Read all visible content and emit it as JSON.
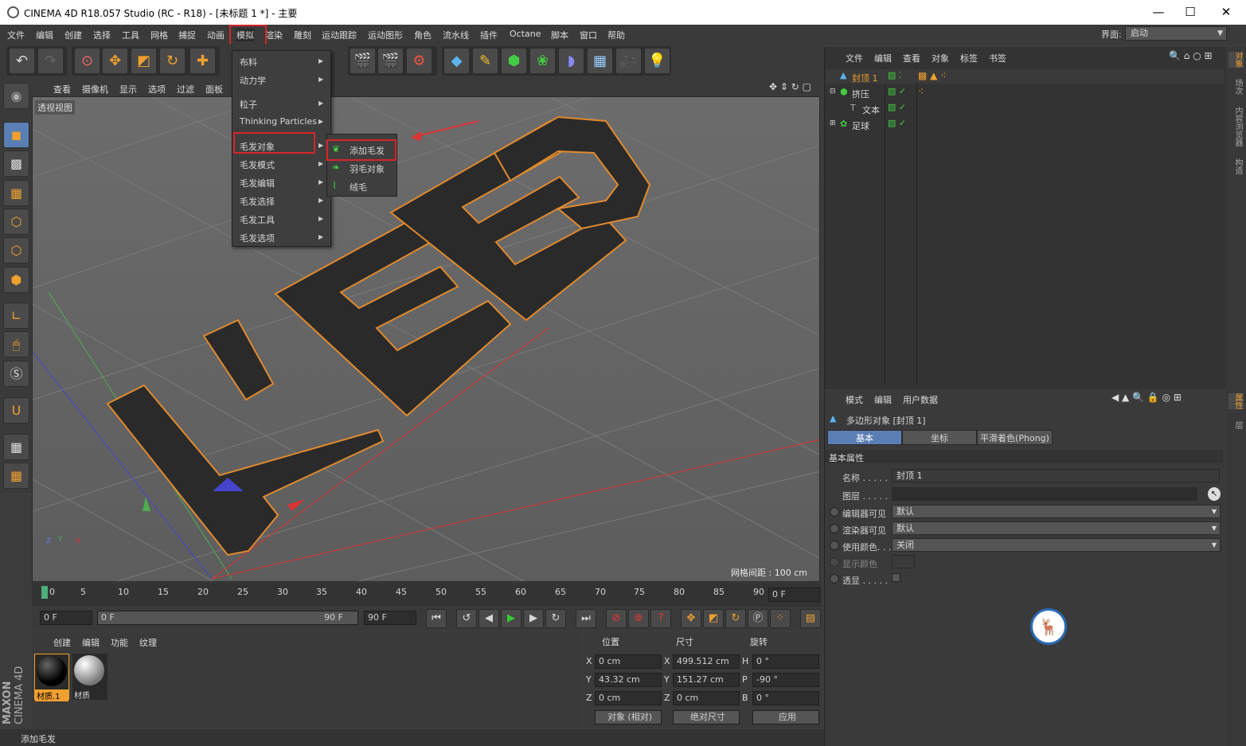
{
  "titlebar": {
    "title": "CINEMA 4D R18.057 Studio (RC - R18) - [未标题 1 *] - 主要",
    "minimize": "—",
    "maximize": "☐",
    "close": "✕"
  },
  "menubar": {
    "items": [
      "文件",
      "编辑",
      "创建",
      "选择",
      "工具",
      "网格",
      "捕捉",
      "动画",
      "模拟",
      "渲染",
      "雕刻",
      "运动跟踪",
      "运动图形",
      "角色",
      "流水线",
      "插件",
      "Octane",
      "脚本",
      "窗口",
      "帮助"
    ],
    "layout_label": "界面:",
    "layout_value": "启动"
  },
  "viewport": {
    "menu": [
      "查看",
      "摄像机",
      "显示",
      "选项",
      "过滤",
      "面板"
    ],
    "label": "透视视图",
    "grid_distance": "网格间距 : 100 cm",
    "scene_text": "KEEP"
  },
  "dropdown": {
    "items": [
      "布料",
      "动力学",
      "粒子",
      "Thinking Particles",
      "毛发对象",
      "毛发模式",
      "毛发编辑",
      "毛发选择",
      "毛发工具",
      "毛发选项"
    ]
  },
  "submenu": {
    "items": [
      "添加毛发",
      "羽毛对象",
      "绒毛"
    ]
  },
  "timeline": {
    "ticks": [
      "0",
      "5",
      "10",
      "15",
      "20",
      "25",
      "30",
      "35",
      "40",
      "45",
      "50",
      "55",
      "60",
      "65",
      "70",
      "75",
      "80",
      "85",
      "90"
    ],
    "current_frame": "0 F",
    "start": "0 F",
    "range_start": "0 F",
    "range_end": "90 F",
    "end": "90 F"
  },
  "materials": {
    "menu": [
      "创建",
      "编辑",
      "功能",
      "纹理"
    ],
    "items": [
      "材质.1",
      "材质"
    ]
  },
  "coords": {
    "headers": [
      "位置",
      "尺寸",
      "旋转"
    ],
    "rows": [
      {
        "axis": "X",
        "pos": "0 cm",
        "sizeAxis": "X",
        "size": "499.512 cm",
        "rotAxis": "H",
        "rot": "0 °"
      },
      {
        "axis": "Y",
        "pos": "43.32 cm",
        "sizeAxis": "Y",
        "size": "151.27 cm",
        "rotAxis": "P",
        "rot": "-90 °"
      },
      {
        "axis": "Z",
        "pos": "0 cm",
        "sizeAxis": "Z",
        "size": "0 cm",
        "rotAxis": "B",
        "rot": "0 °"
      }
    ],
    "mode": "对象 (相对)",
    "size_mode": "绝对尺寸",
    "apply": "应用"
  },
  "statusbar": {
    "text": "添加毛发"
  },
  "brand": {
    "maxon": "MAXON",
    "c4d": "CINEMA 4D"
  },
  "objects": {
    "menu": [
      "文件",
      "编辑",
      "查看",
      "对象",
      "标签",
      "书签"
    ],
    "rows": [
      "封顶 1",
      "挤压",
      "文本",
      "足球"
    ]
  },
  "attributes": {
    "menu": [
      "模式",
      "编辑",
      "用户数据"
    ],
    "object_title": "多边形对象 [封顶 1]",
    "tabs": [
      "基本",
      "坐标",
      "平滑着色(Phong)"
    ],
    "section": "基本属性",
    "props": [
      {
        "label": "名称 . . . . .",
        "value": "封顶 1"
      },
      {
        "label": "图层 . . . . .",
        "value": ""
      },
      {
        "label": "编辑器可见",
        "value": "默认"
      },
      {
        "label": "渲染器可见",
        "value": "默认"
      },
      {
        "label": "使用颜色. . .",
        "value": "关闭"
      },
      {
        "label": "显示颜色",
        "value": ""
      },
      {
        "label": "透显 . . . . .",
        "value": ""
      }
    ]
  },
  "right_tabs": [
    "对象",
    "场次",
    "内容浏览器",
    "构造",
    "属性",
    "层"
  ],
  "colors": {
    "accent": "#f0a030",
    "highlight_red": "#d9242b",
    "selected_tab": "#5a7fb5"
  }
}
